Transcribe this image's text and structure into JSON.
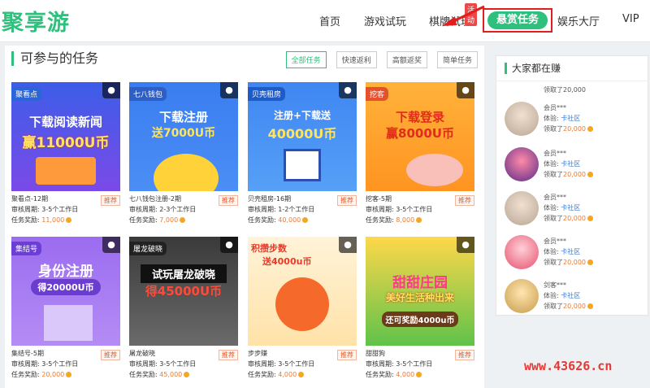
{
  "header": {
    "logo": "聚享游",
    "nav": [
      {
        "label": "首页"
      },
      {
        "label": "游戏试玩"
      },
      {
        "label": "棋牌试玩"
      },
      {
        "label": "悬赏任务"
      },
      {
        "label": "娱乐大厅"
      },
      {
        "label": "VIP"
      }
    ],
    "badge": "活动"
  },
  "main": {
    "title": "可参与的任务",
    "filters": [
      "全部任务",
      "快速返利",
      "高额返奖",
      "简单任务"
    ],
    "cards": [
      {
        "tag": "聚看点",
        "headline1": "下载阅读新闻",
        "headline2": "赢11000U币",
        "name": "聚看点-12期",
        "rec": "推荐",
        "review": "审核周期: 3-5个工作日",
        "reward_label": "任务奖励: ",
        "reward": "11,000"
      },
      {
        "tag": "七八钱包",
        "headline1": "下载注册",
        "headline2": "送7000U币",
        "name": "七八钱包注册-2期",
        "rec": "推荐",
        "review": "审核周期: 2-3个工作日",
        "reward_label": "任务奖励: ",
        "reward": "7,000"
      },
      {
        "tag": "贝壳租房",
        "headline1": "注册+下载送",
        "headline2": "40000U币",
        "name": "贝壳租房-16期",
        "rec": "推荐",
        "review": "审核周期: 1-2个工作日",
        "reward_label": "任务奖励: ",
        "reward": "40,000"
      },
      {
        "tag": "挖客",
        "headline1": "下载登录",
        "headline2": "赢8000U币",
        "name": "挖客-5期",
        "rec": "推荐",
        "review": "审核周期: 3-5个工作日",
        "reward_label": "任务奖励: ",
        "reward": "8,000"
      },
      {
        "tag": "集结号",
        "headline1": "身份注册",
        "headline2": "得20000U币",
        "name": "集结号-5期",
        "rec": "推荐",
        "review": "审核周期: 3-5个工作日",
        "reward_label": "任务奖励: ",
        "reward": "20,000"
      },
      {
        "tag": "屠龙破晓",
        "headline1": "试玩屠龙破晓",
        "headline2": "得45000U币",
        "name": "屠龙破晓",
        "rec": "推荐",
        "review": "审核周期: 3-5个工作日",
        "reward_label": "任务奖励: ",
        "reward": "45,000"
      },
      {
        "tag": "",
        "headline1": "积攒步数",
        "headline2": "送4000u币",
        "name": "步步赚",
        "rec": "推荐",
        "review": "审核周期: 3-5个工作日",
        "reward_label": "任务奖励: ",
        "reward": "4,000"
      },
      {
        "tag": "",
        "headline1": "甜甜庄园",
        "headline2": "美好生活种出来",
        "headline3": "还可奖励4000u币",
        "name": "甜甜狗",
        "rec": "推荐",
        "review": "审核周期: 3-5个工作日",
        "reward_label": "任务奖励: ",
        "reward": "4,000"
      }
    ]
  },
  "sidebar": {
    "title": "大家都在赚",
    "partial_top": "领取了20,000",
    "users": [
      {
        "name": "会员***",
        "exp_label": "体验:",
        "exp": "卡社区",
        "got_label": "领取了",
        "got": "20,000"
      },
      {
        "name": "会员***",
        "exp_label": "体验:",
        "exp": "卡社区",
        "got_label": "领取了",
        "got": "20,000"
      },
      {
        "name": "会员***",
        "exp_label": "体验:",
        "exp": "卡社区",
        "got_label": "领取了",
        "got": "20,000"
      },
      {
        "name": "会员***",
        "exp_label": "体验:",
        "exp": "卡社区",
        "got_label": "领取了",
        "got": "20,000"
      },
      {
        "name": "剑客***",
        "exp_label": "体验:",
        "exp": "卡社区",
        "got_label": "领取了",
        "got": "20,000"
      }
    ]
  },
  "watermark": "www.43626.cn",
  "colors": {
    "brand": "#2ec07c",
    "highlight": "#e21d1d",
    "reward": "#f0782d",
    "link": "#3a7bd5"
  }
}
